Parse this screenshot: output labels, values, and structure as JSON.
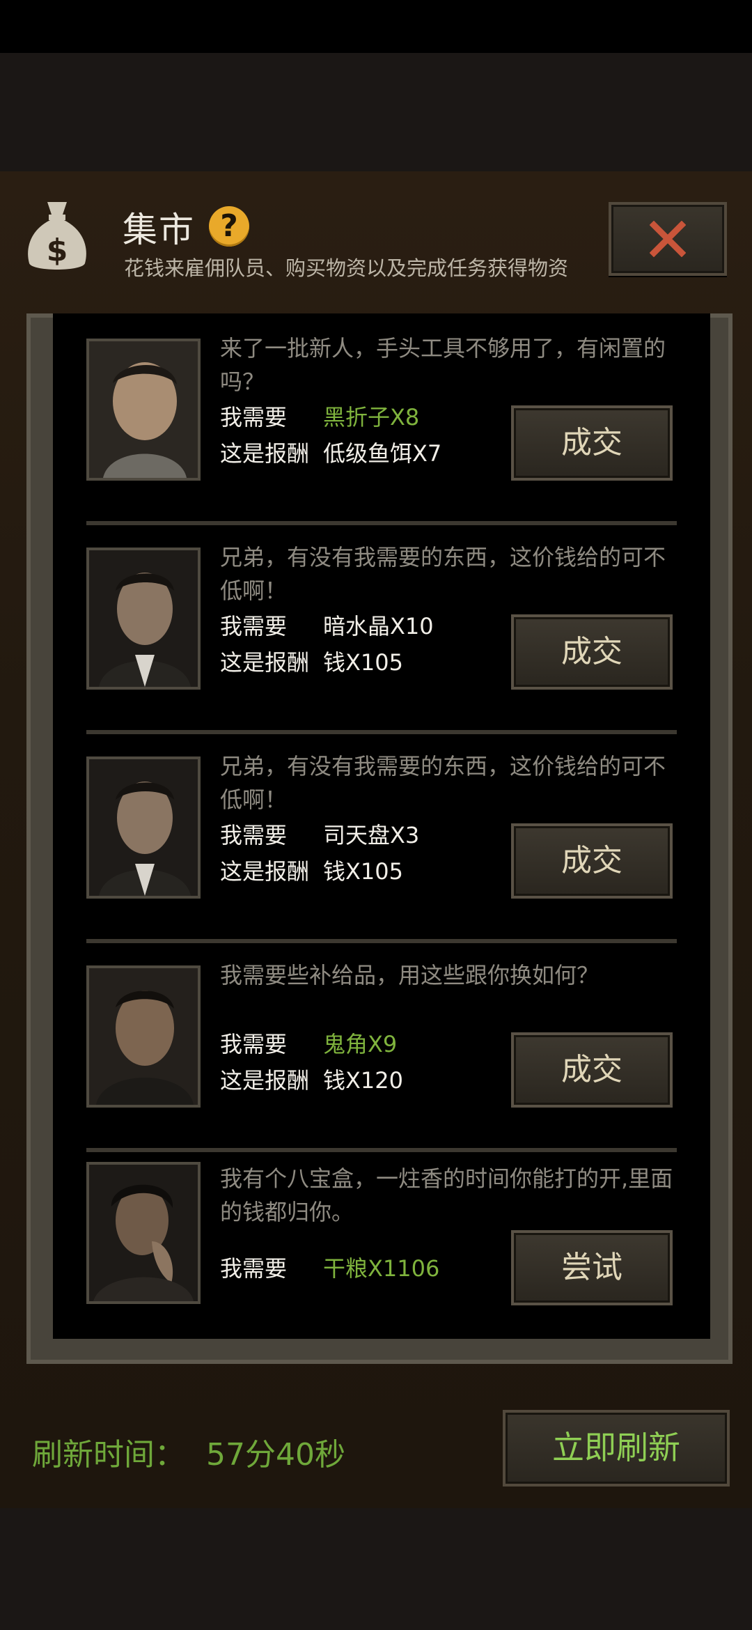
{
  "header": {
    "title": "集市",
    "subtitle": "花钱来雇佣队员、购买物资以及完成任务获得物资",
    "help_icon": "?"
  },
  "colors": {
    "need_highlight": "#7fb33d",
    "need_normal": "#f2efe8",
    "refresh_text": "#8fcf54"
  },
  "labels": {
    "need": "我需要",
    "reward": "这是报酬"
  },
  "items": [
    {
      "message": "来了一批新人，手头工具不够用了，有闲置的吗？",
      "need": "黑折子X8",
      "need_highlight": true,
      "reward": "低级鱼饵X7",
      "button": "成交"
    },
    {
      "message": "兄弟，有没有我需要的东西，这价钱给的可不低啊！",
      "need": "暗水晶X10",
      "need_highlight": false,
      "reward": "钱X105",
      "button": "成交"
    },
    {
      "message": "兄弟，有没有我需要的东西，这价钱给的可不低啊！",
      "need": "司天盘X3",
      "need_highlight": false,
      "reward": "钱X105",
      "button": "成交"
    },
    {
      "message": "我需要些补给品，用这些跟你换如何？",
      "need": "鬼角X9",
      "need_highlight": true,
      "reward": "钱X120",
      "button": "成交"
    },
    {
      "message": "我有个八宝盒，一炷香的时间你能打的开,里面的钱都归你。",
      "need": "干粮X1106",
      "need_highlight": true,
      "reward": null,
      "button": "尝试"
    }
  ],
  "footer": {
    "refresh_label": "刷新时间：",
    "refresh_time": "57分40秒",
    "refresh_button": "立即刷新"
  }
}
